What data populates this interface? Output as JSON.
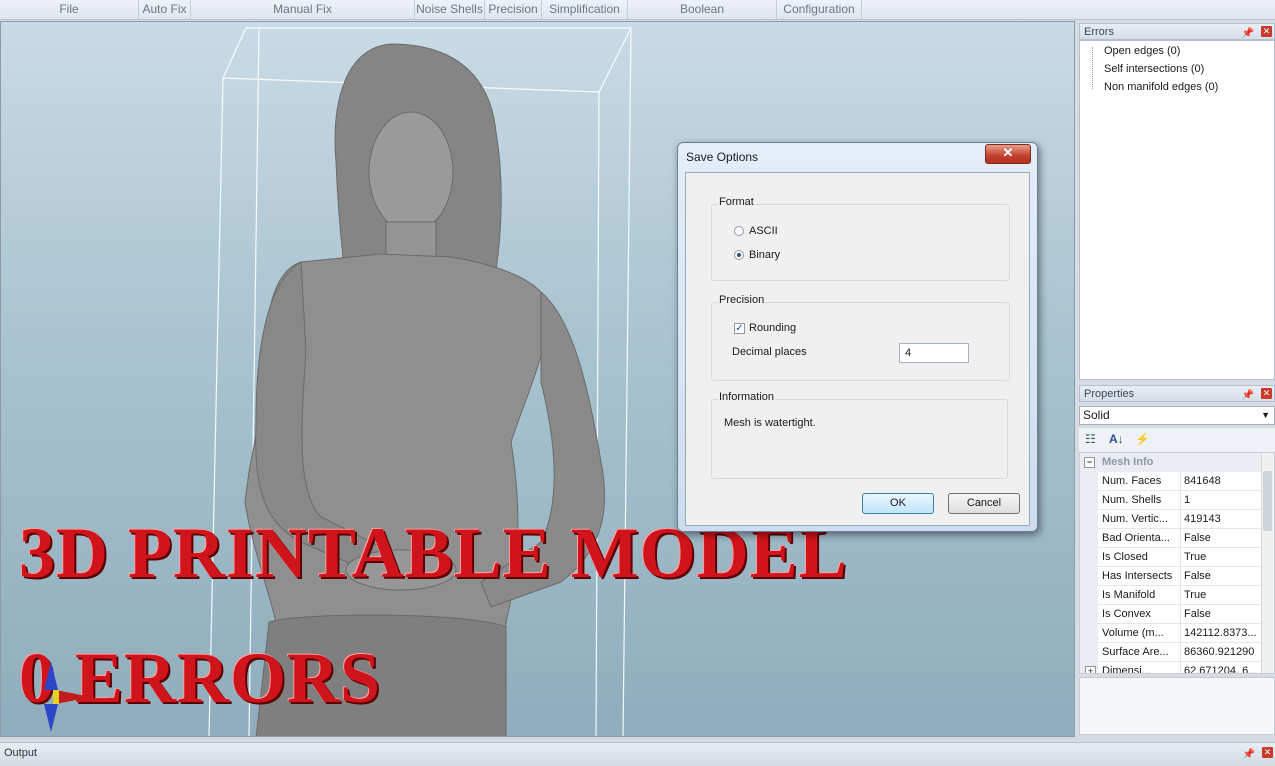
{
  "ribbon": {
    "groups": [
      "File",
      "Auto Fix",
      "Manual Fix",
      "Noise Shells",
      "Precision",
      "Simplification",
      "Boolean",
      "Configuration"
    ]
  },
  "overlay": {
    "line1": "3D PRINTABLE MODEL",
    "line2": "0 ERRORS"
  },
  "dialog": {
    "title": "Save Options",
    "close_label": "✕",
    "format": {
      "label": "Format",
      "options": [
        "ASCII",
        "Binary"
      ],
      "selected": "Binary"
    },
    "precision": {
      "label": "Precision",
      "rounding_label": "Rounding",
      "rounding_checked": true,
      "decimal_label": "Decimal places",
      "decimal_value": "4"
    },
    "information": {
      "label": "Information",
      "text": "Mesh is watertight."
    },
    "ok_label": "OK",
    "cancel_label": "Cancel"
  },
  "errors_panel": {
    "title": "Errors",
    "items": [
      "Open edges (0)",
      "Self intersections (0)",
      "Non manifold edges (0)"
    ]
  },
  "properties_panel": {
    "title": "Properties",
    "selector": "Solid",
    "category": "Mesh Info",
    "rows": [
      {
        "name": "Num. Faces",
        "value": "841648"
      },
      {
        "name": "Num. Shells",
        "value": "1"
      },
      {
        "name": "Num. Vertic...",
        "value": "419143"
      },
      {
        "name": "Bad Orienta...",
        "value": "False"
      },
      {
        "name": "Is Closed",
        "value": "True"
      },
      {
        "name": "Has Intersects",
        "value": "False"
      },
      {
        "name": "Is Manifold",
        "value": "True"
      },
      {
        "name": "Is Convex",
        "value": "False"
      },
      {
        "name": "Volume (m...",
        "value": "142112.8373..."
      },
      {
        "name": "Surface Are...",
        "value": "86360.921290"
      },
      {
        "name": "Dimensi...",
        "value": "62.671204, 6..."
      }
    ]
  },
  "output_panel": {
    "title": "Output"
  },
  "colors": {
    "overlay_text": "#d0141b",
    "viewport_top": "#c9dbe6",
    "viewport_bottom": "#8fadbc"
  }
}
